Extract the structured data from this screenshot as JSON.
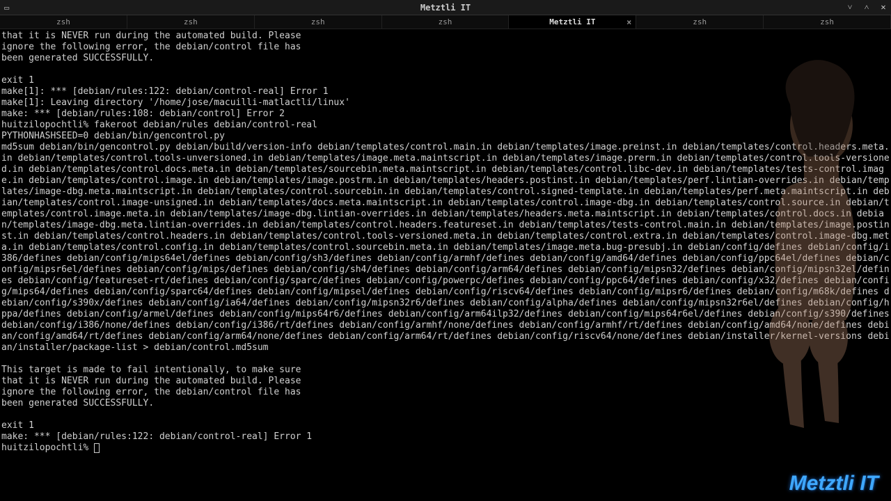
{
  "window": {
    "title": "Metztli IT"
  },
  "tabs": [
    {
      "label": "zsh",
      "active": false
    },
    {
      "label": "zsh",
      "active": false
    },
    {
      "label": "zsh",
      "active": false
    },
    {
      "label": "zsh",
      "active": false
    },
    {
      "label": "Metztli IT",
      "active": true
    },
    {
      "label": "zsh",
      "active": false
    },
    {
      "label": "zsh",
      "active": false
    }
  ],
  "terminal": {
    "lines": [
      "that it is NEVER run during the automated build. Please",
      "ignore the following error, the debian/control file has",
      "been generated SUCCESSFULLY.",
      "",
      "exit 1",
      "make[1]: *** [debian/rules:122: debian/control-real] Error 1",
      "make[1]: Leaving directory '/home/jose/macuilli-matlactli/linux'",
      "make: *** [debian/rules:108: debian/control] Error 2",
      "huitzilopochtli% fakeroot debian/rules debian/control-real",
      "PYTHONHASHSEED=0 debian/bin/gencontrol.py",
      "md5sum debian/bin/gencontrol.py debian/build/version-info debian/templates/control.main.in debian/templates/image.preinst.in debian/templates/control.headers.meta.in debian/templates/control.tools-unversioned.in debian/templates/image.meta.maintscript.in debian/templates/image.prerm.in debian/templates/control.tools-versioned.in debian/templates/control.docs.meta.in debian/templates/sourcebin.meta.maintscript.in debian/templates/control.libc-dev.in debian/templates/tests-control.image.in debian/templates/control.image.in debian/templates/image.postrm.in debian/templates/headers.postinst.in debian/templates/perf.lintian-overrides.in debian/templates/image-dbg.meta.maintscript.in debian/templates/control.sourcebin.in debian/templates/control.signed-template.in debian/templates/perf.meta.maintscript.in debian/templates/control.image-unsigned.in debian/templates/docs.meta.maintscript.in debian/templates/control.image-dbg.in debian/templates/control.source.in debian/templates/control.image.meta.in debian/templates/image-dbg.lintian-overrides.in debian/templates/headers.meta.maintscript.in debian/templates/control.docs.in debian/templates/image-dbg.meta.lintian-overrides.in debian/templates/control.headers.featureset.in debian/templates/tests-control.main.in debian/templates/image.postinst.in debian/templates/control.headers.in debian/templates/control.tools-versioned.meta.in debian/templates/control.extra.in debian/templates/control.image-dbg.meta.in debian/templates/control.config.in debian/templates/control.sourcebin.meta.in debian/templates/image.meta.bug-presubj.in debian/config/defines debian/config/i386/defines debian/config/mips64el/defines debian/config/sh3/defines debian/config/armhf/defines debian/config/amd64/defines debian/config/ppc64el/defines debian/config/mipsr6el/defines debian/config/mips/defines debian/config/sh4/defines debian/config/arm64/defines debian/config/mipsn32/defines debian/config/mipsn32el/defines debian/config/featureset-rt/defines debian/config/sparc/defines debian/config/powerpc/defines debian/config/ppc64/defines debian/config/x32/defines debian/config/mips64/defines debian/config/sparc64/defines debian/config/mipsel/defines debian/config/riscv64/defines debian/config/mipsr6/defines debian/config/m68k/defines debian/config/s390x/defines debian/config/ia64/defines debian/config/mipsn32r6/defines debian/config/alpha/defines debian/config/mipsn32r6el/defines debian/config/hppa/defines debian/config/armel/defines debian/config/mips64r6/defines debian/config/arm64ilp32/defines debian/config/mips64r6el/defines debian/config/s390/defines debian/config/i386/none/defines debian/config/i386/rt/defines debian/config/armhf/none/defines debian/config/armhf/rt/defines debian/config/amd64/none/defines debian/config/amd64/rt/defines debian/config/arm64/none/defines debian/config/arm64/rt/defines debian/config/riscv64/none/defines debian/installer/kernel-versions debian/installer/package-list > debian/control.md5sum",
      "",
      "This target is made to fail intentionally, to make sure",
      "that it is NEVER run during the automated build. Please",
      "ignore the following error, the debian/control file has",
      "been generated SUCCESSFULLY.",
      "",
      "exit 1",
      "make: *** [debian/rules:122: debian/control-real] Error 1"
    ],
    "prompt": "huitzilopochtli% "
  },
  "watermark": "Metztli IT"
}
